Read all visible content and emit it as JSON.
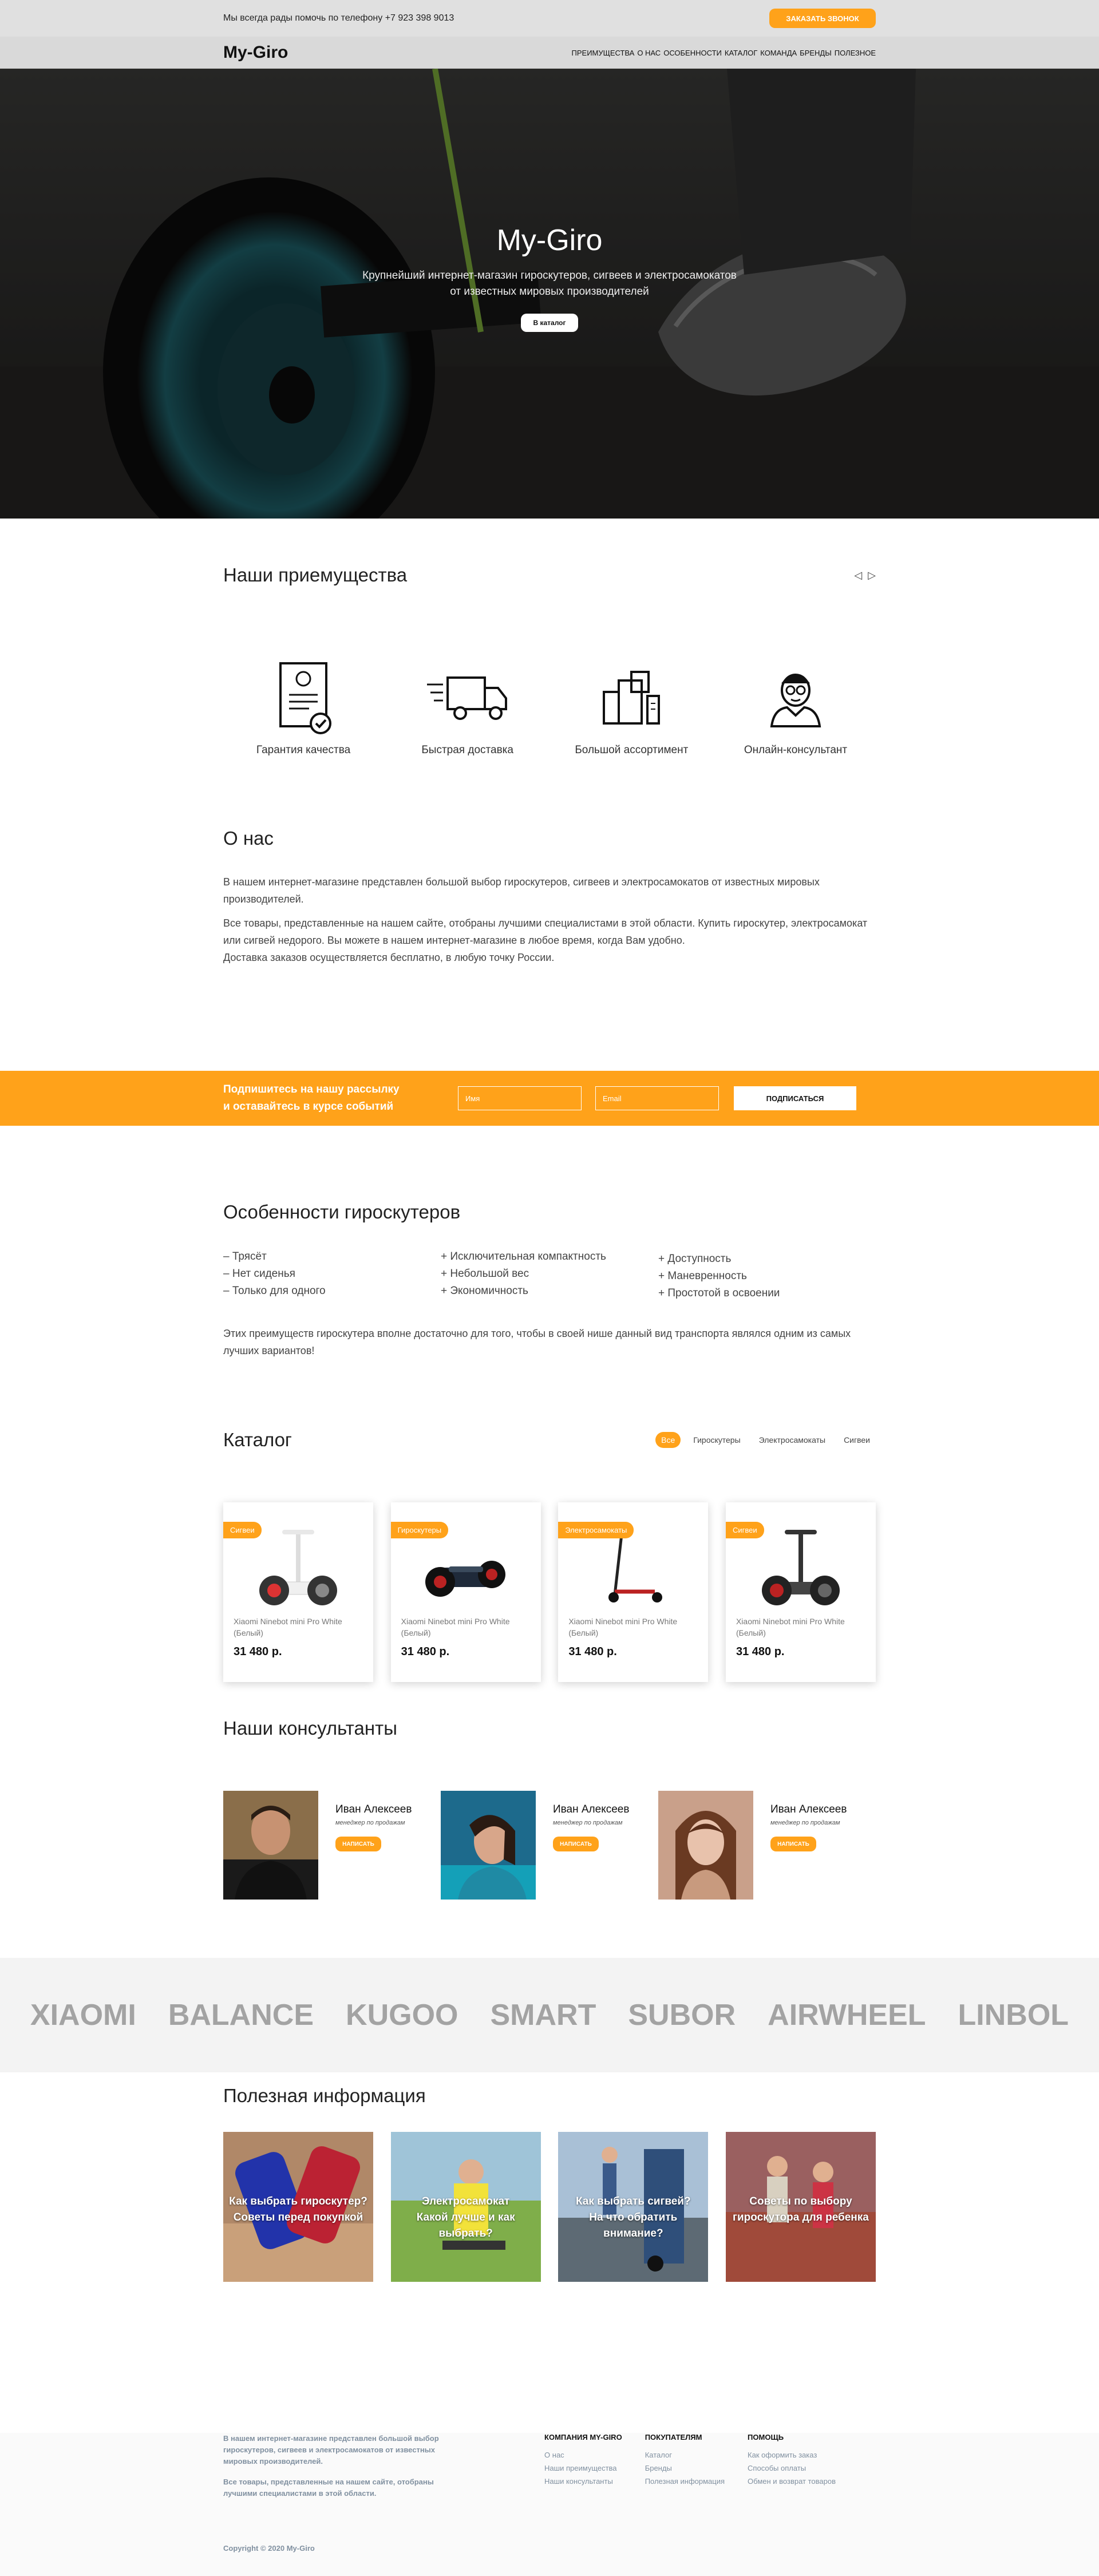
{
  "topbar": {
    "phone_text": "Мы всегда рады помочь по телефону +7 923 398 9013",
    "callback_label": "Заказать звонок"
  },
  "nav": {
    "logo": "My-Giro",
    "items": [
      "Преимущества",
      "О нас",
      "Особенности",
      "Каталог",
      "Команда",
      "Бренды",
      "Полезное"
    ]
  },
  "hero": {
    "title": "My-Giro",
    "subtitle_line1": "Крупнейший интернет-магазин гироскутеров, сигвеев и электросамокатов",
    "subtitle_line2": "от известных мировых производителей",
    "button": "В каталог"
  },
  "advantages": {
    "title": "Наши приемущества",
    "prev": "◁",
    "next": "▷",
    "items": [
      {
        "label": "Гарантия качества",
        "icon": "certificate-icon"
      },
      {
        "label": "Быстрая доставка",
        "icon": "truck-icon"
      },
      {
        "label": "Большой ассортимент",
        "icon": "boxes-icon"
      },
      {
        "label": "Онлайн-консультант",
        "icon": "consultant-icon"
      }
    ]
  },
  "about": {
    "title": "О нас",
    "p1": "В нашем интернет-магазине представлен большой выбор гироскутеров, сигвеев и электросамокатов от известных мировых производителей.",
    "p2_line1": "Все товары, представленные на нашем сайте, отобраны лучшими специалистами в этой области. Купить гироскутер, электросамокат или сигвей недорого. Вы можете в нашем интернет-магазине в любое время, когда Вам удобно.",
    "p2_line2": "Доставка заказов осуществляется бесплатно, в любую точку России."
  },
  "subscribe": {
    "line1": "Подпишитесь на нашу рассылку",
    "line2": "и оставайтесь в курсе событий",
    "name_placeholder": "Имя",
    "email_placeholder": "Email",
    "button": "Подписаться"
  },
  "features": {
    "title": "Особенности гироскутеров",
    "col1": [
      "– Трясёт",
      "– Нет сиденья",
      "– Только для одного"
    ],
    "col2": [
      "+ Исключительная компактность",
      "+ Небольшой вес",
      "+ Экономичность"
    ],
    "col3": [
      "+ Доступность",
      "+ Маневренность",
      "+ Простотой в освоении"
    ],
    "note": "Этих преимуществ гироскутера вполне достаточно для того, чтобы в своей нише данный вид транспорта являлся одним из самых лучших вариантов!"
  },
  "catalog": {
    "title": "Каталог",
    "filters": [
      "Все",
      "Гироскутеры",
      "Электросамокаты",
      "Сигвеи"
    ],
    "active_filter": "Все",
    "products": [
      {
        "badge": "Сигвеи",
        "name": "Xiaomi Ninebot mini Pro White (Белый)",
        "price": "31 480 р."
      },
      {
        "badge": "Гироскутеры",
        "name": "Xiaomi Ninebot mini Pro White (Белый)",
        "price": "31 480 р."
      },
      {
        "badge": "Электросамокаты",
        "name": "Xiaomi Ninebot mini Pro White (Белый)",
        "price": "31 480 р."
      },
      {
        "badge": "Сигвеи",
        "name": "Xiaomi Ninebot mini Pro White (Белый)",
        "price": "31 480 р."
      }
    ]
  },
  "consultants": {
    "title": "Наши консультанты",
    "people": [
      {
        "name": "Иван Алексеев",
        "role": "менеджер по продажам",
        "button": "написать"
      },
      {
        "name": "Иван Алексеев",
        "role": "менеджер по продажам",
        "button": "написать"
      },
      {
        "name": "Иван Алексеев",
        "role": "менеджер по продажам",
        "button": "написать"
      }
    ]
  },
  "brands": [
    "XIAOMI",
    "BALANCE",
    "KUGOO",
    "SMART",
    "SUBOR",
    "AIRWHEEL",
    "LINBOL"
  ],
  "useful": {
    "title": "Полезная информация",
    "tiles": [
      {
        "line1": "Как выбрать гироскутер?",
        "line2": "Советы перед покупкой"
      },
      {
        "line1": "Электросамокат",
        "line2": "Какой лучше и как выбрать?"
      },
      {
        "line1": "Как выбрать сигвей?",
        "line2": "На что обратить внимание?"
      },
      {
        "line1": "Советы по выбору",
        "line2": "гироскутора для ребенка"
      }
    ]
  },
  "footer": {
    "about1": "В нашем интернет-магазине представлен большой выбор гироскутеров, сигвеев и электросамокатов от известных мировых производителей.",
    "about2": "Все товары, представленные на нашем сайте, отобраны лучшими специалистами в этой области.",
    "cols": [
      {
        "title": "Компания MY-GIRO",
        "links": [
          "О нас",
          "Наши преимущества",
          "Наши консультанты"
        ]
      },
      {
        "title": "Покупателям",
        "links": [
          "Каталог",
          "Бренды",
          "Полезная информация"
        ]
      },
      {
        "title": "Помощь",
        "links": [
          "Как оформить заказ",
          "Способы оплаты",
          "Обмен и возврат товаров"
        ]
      }
    ],
    "copyright": "Copyright © 2020 My-Giro"
  },
  "colors": {
    "accent": "#ffa21a",
    "brand_text": "#a3a3a3"
  }
}
